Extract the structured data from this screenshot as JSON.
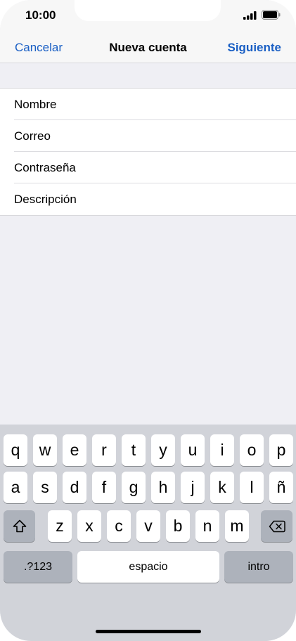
{
  "status": {
    "time": "10:00"
  },
  "nav": {
    "cancel": "Cancelar",
    "title": "Nueva cuenta",
    "next": "Siguiente"
  },
  "form": {
    "fields": [
      {
        "placeholder": "Nombre"
      },
      {
        "placeholder": "Correo"
      },
      {
        "placeholder": "Contraseña"
      },
      {
        "placeholder": "Descripción"
      }
    ]
  },
  "keyboard": {
    "row1": [
      "q",
      "w",
      "e",
      "r",
      "t",
      "y",
      "u",
      "i",
      "o",
      "p"
    ],
    "row2": [
      "a",
      "s",
      "d",
      "f",
      "g",
      "h",
      "j",
      "k",
      "l",
      "ñ"
    ],
    "row3": [
      "z",
      "x",
      "c",
      "v",
      "b",
      "n",
      "m"
    ],
    "numbers_key": ".?123",
    "space_key": "espacio",
    "return_key": "intro",
    "shift_icon": "shift-icon",
    "delete_icon": "backspace-icon"
  },
  "colors": {
    "accent": "#1a5fc4",
    "keyboard_bg": "#d1d3d9",
    "key_dark": "#adb2bb"
  }
}
